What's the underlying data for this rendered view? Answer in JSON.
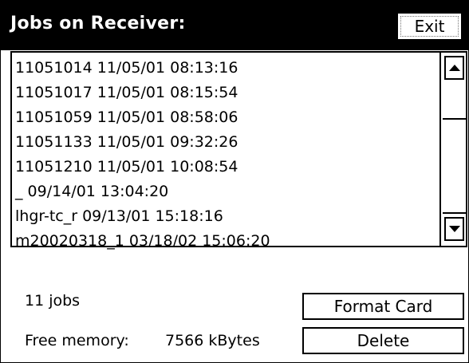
{
  "window": {
    "title": "Jobs on Receiver:",
    "exit_label": "Exit"
  },
  "jobs": {
    "items": [
      "11051014 11/05/01 08:13:16",
      "11051017 11/05/01 08:15:54",
      "11051059 11/05/01 08:58:06",
      "11051133 11/05/01 09:32:26",
      "11051210 11/05/01 10:08:54",
      "_ 09/14/01 13:04:20",
      "lhgr-tc_r 09/13/01 15:18:16",
      "m20020318_1 03/18/02 15:06:20"
    ],
    "count_label": "11 jobs",
    "free_memory_label": "Free memory:",
    "free_memory_value": "7566 kBytes"
  },
  "actions": {
    "format_card_label": "Format Card",
    "delete_label": "Delete"
  },
  "icons": {
    "scroll_up": "scroll-up-arrow-icon",
    "scroll_down": "scroll-down-arrow-icon"
  }
}
